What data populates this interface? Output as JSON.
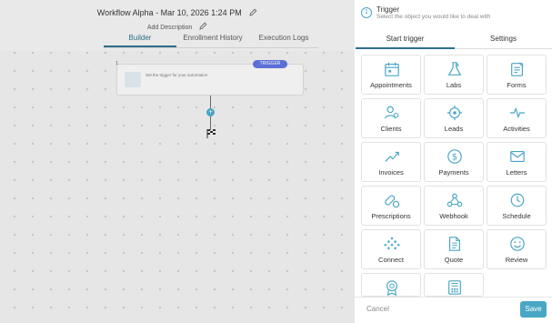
{
  "header": {
    "workflow_title": "Workflow Alpha - Mar 10, 2026 1:24 PM",
    "add_description": "Add Description",
    "tabs": [
      "Builder",
      "Enrollment History",
      "Execution Logs"
    ]
  },
  "canvas": {
    "node_number": "1",
    "trigger_badge": "TRIGGER",
    "node_text": "Set the trigger for your automation"
  },
  "panel": {
    "step_number": "1",
    "title": "Trigger",
    "subtitle": "Select the object you would like to deal with",
    "tabs": [
      "Start trigger",
      "Settings"
    ],
    "tiles": [
      {
        "label": "Appointments",
        "icon": "calendar-icon"
      },
      {
        "label": "Labs",
        "icon": "flask-icon"
      },
      {
        "label": "Forms",
        "icon": "form-icon"
      },
      {
        "label": "Clients",
        "icon": "users-icon"
      },
      {
        "label": "Leads",
        "icon": "target-icon"
      },
      {
        "label": "Activities",
        "icon": "pulse-icon"
      },
      {
        "label": "Invoices",
        "icon": "trend-icon"
      },
      {
        "label": "Payments",
        "icon": "dollar-icon"
      },
      {
        "label": "Letters",
        "icon": "envelope-icon"
      },
      {
        "label": "Prescriptions",
        "icon": "pills-icon"
      },
      {
        "label": "Webhook",
        "icon": "webhook-icon"
      },
      {
        "label": "Schedule",
        "icon": "clock-icon"
      },
      {
        "label": "Connect",
        "icon": "connect-icon"
      },
      {
        "label": "Quote",
        "icon": "document-icon"
      },
      {
        "label": "Review",
        "icon": "smiley-icon"
      },
      {
        "label": "",
        "icon": "badge-icon"
      },
      {
        "label": "",
        "icon": "fax-icon"
      }
    ],
    "cancel_label": "Cancel",
    "save_label": "Save",
    "accent_color": "#49a6c4"
  }
}
